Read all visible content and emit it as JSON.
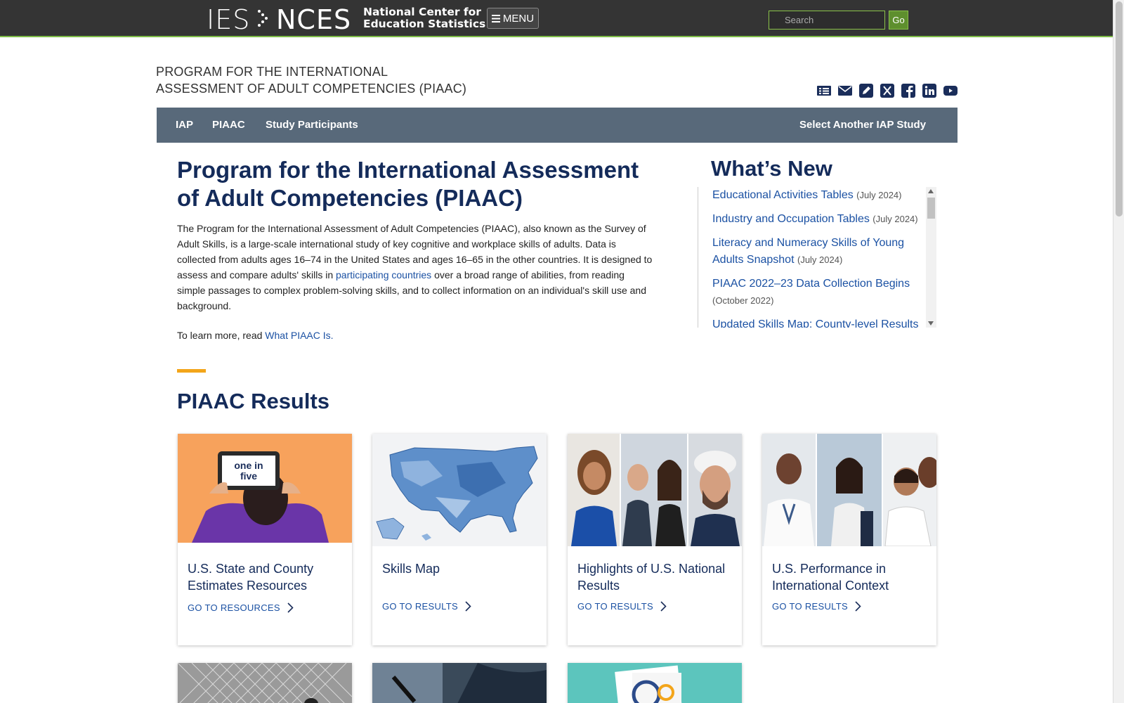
{
  "header": {
    "logo_ies": "IES",
    "logo_nces": "NCES",
    "logo_line1": "National Center for",
    "logo_line2": "Education Statistics",
    "menu_label": "MENU",
    "search_placeholder": "Search",
    "go_label": "Go"
  },
  "program": {
    "title_line1": "PROGRAM FOR THE INTERNATIONAL",
    "title_line2": "ASSESSMENT OF ADULT COMPETENCIES (PIAAC)"
  },
  "social_icons": [
    "newsletter-icon",
    "email-icon",
    "blog-icon",
    "x-twitter-icon",
    "facebook-icon",
    "linkedin-icon",
    "youtube-icon"
  ],
  "nav": {
    "iap": "IAP",
    "piaac": "PIAAC",
    "participants": "Study Participants",
    "select": "Select Another IAP Study"
  },
  "intro": {
    "heading": "Program for the International Assessment of Adult Competencies (PIAAC)",
    "para_before": "The Program for the International Assessment of Adult Competencies (PIAAC), also known as the Survey of Adult Skills, is a large-scale international study of key cognitive and workplace skills of adults. Data is collected from adults ages 16–74 in the United States and ages 16–65 in the other countries. It is designed to assess and compare adults' skills in ",
    "para_link": "participating countries",
    "para_after": " over a broad range of abilities, from reading simple passages to complex problem-solving skills, and to collect information on an individual's skill use and background.",
    "learn_prefix": "To learn more, read ",
    "learn_link": "What PIAAC Is."
  },
  "whats_new": {
    "title": "What’s New",
    "items": [
      {
        "label": "Educational Activities Tables",
        "date": "(July 2024)"
      },
      {
        "label": "Industry and Occupation Tables",
        "date": "(July 2024)"
      },
      {
        "label": "Literacy and Numeracy Skills of Young Adults Snapshot",
        "date": "(July 2024)"
      },
      {
        "label": "PIAAC 2022–23 Data Collection Begins",
        "date": "(October 2022)"
      },
      {
        "label": "Updated Skills Map: County-level Results",
        "date": ""
      }
    ]
  },
  "results": {
    "title": "PIAAC Results",
    "cards": [
      {
        "title": "U.S. State and County Estimates Resources",
        "link": "GO TO RESOURCES",
        "img_text": "one in five"
      },
      {
        "title": "Skills Map",
        "link": "GO TO RESULTS"
      },
      {
        "title": "Highlights of U.S. National Results",
        "link": "GO TO RESULTS"
      },
      {
        "title": "U.S. Performance in International Context",
        "link": "GO TO RESULTS"
      }
    ]
  },
  "colors": {
    "header_bg": "#343434",
    "nav_bg": "#58697a",
    "heading": "#142b5a",
    "link": "#1b51a3",
    "accent": "#f3a51a"
  }
}
